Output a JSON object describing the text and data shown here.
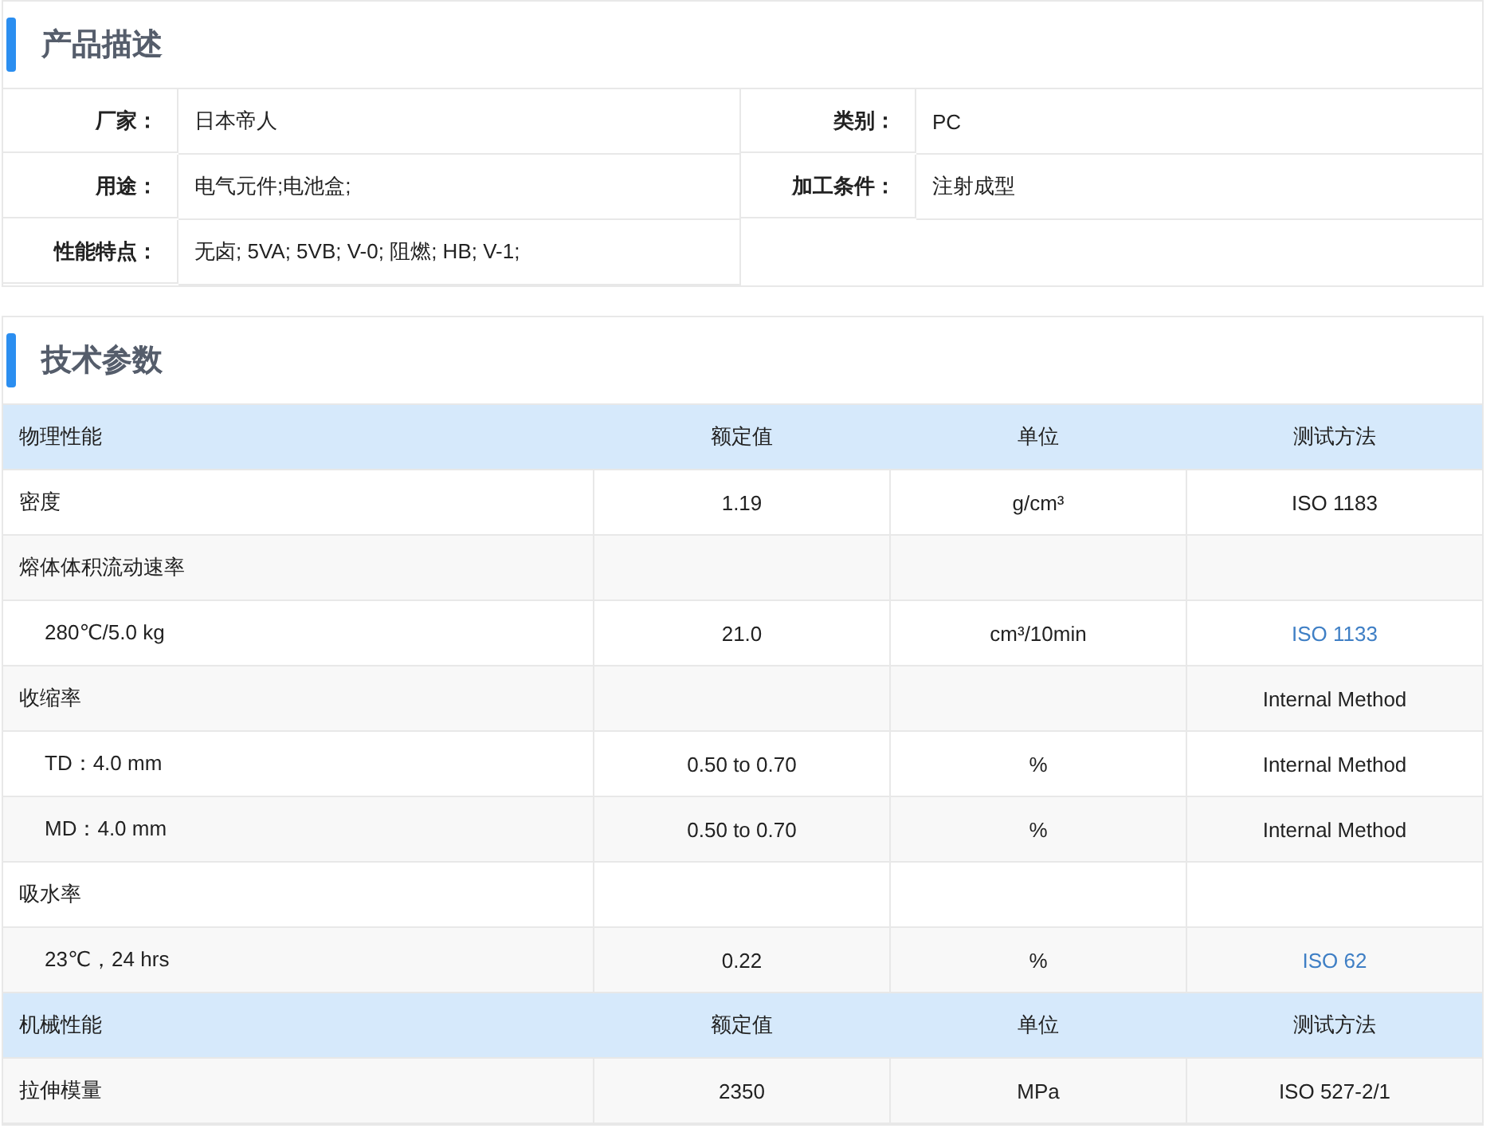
{
  "description": {
    "title": "产品描述",
    "fields": [
      {
        "label": "厂家：",
        "value": "日本帝人"
      },
      {
        "label": "类别：",
        "value": "PC"
      },
      {
        "label": "用途：",
        "value": "电气元件;电池盒;"
      },
      {
        "label": "加工条件：",
        "value": "注射成型"
      },
      {
        "label": "性能特点：",
        "value": "无卤; 5VA; 5VB; V-0; 阻燃; HB; V-1;"
      }
    ]
  },
  "parameters": {
    "title": "技术参数",
    "rows": [
      {
        "kind": "header",
        "name": "物理性能",
        "value": "额定值",
        "unit": "单位",
        "method": "测试方法"
      },
      {
        "kind": "item",
        "name": "密度",
        "value": "1.19",
        "unit": "g/cm³",
        "method": "ISO 1183"
      },
      {
        "kind": "item",
        "name": "熔体体积流动速率"
      },
      {
        "kind": "sub",
        "name": "280℃/5.0 kg",
        "value": "21.0",
        "unit": "cm³/10min",
        "method": "ISO 1133",
        "link": true
      },
      {
        "kind": "item",
        "name": "收缩率",
        "method": "Internal Method"
      },
      {
        "kind": "sub",
        "name": "TD：4.0 mm",
        "value": "0.50 to 0.70",
        "unit": "%",
        "method": "Internal Method"
      },
      {
        "kind": "sub",
        "name": "MD：4.0 mm",
        "value": "0.50 to 0.70",
        "unit": "%",
        "method": "Internal Method"
      },
      {
        "kind": "item",
        "name": "吸水率"
      },
      {
        "kind": "sub",
        "name": "23℃，24 hrs",
        "value": "0.22",
        "unit": "%",
        "method": "ISO 62",
        "link": true
      },
      {
        "kind": "header",
        "name": "机械性能",
        "value": "额定值",
        "unit": "单位",
        "method": "测试方法"
      },
      {
        "kind": "item",
        "name": "拉伸模量",
        "value": "2350",
        "unit": "MPa",
        "method": "ISO 527-2/1"
      }
    ]
  }
}
